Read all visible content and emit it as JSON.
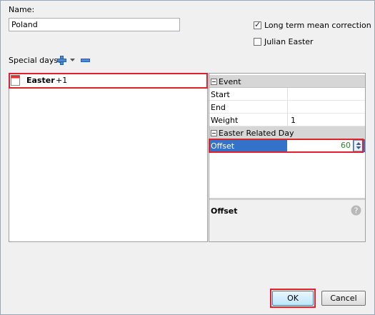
{
  "name_label": "Name:",
  "name_value": "Poland",
  "checkboxes": {
    "long_term": {
      "label": "Long term mean correction",
      "checked": true
    },
    "julian": {
      "label": "Julian Easter",
      "checked": false
    }
  },
  "special_days": {
    "label": "Special days:"
  },
  "list": {
    "items": [
      {
        "name": "Easter",
        "suffix": "+1"
      }
    ]
  },
  "properties": {
    "event_category": "Event",
    "start_label": "Start",
    "start_value": "",
    "end_label": "End",
    "end_value": "",
    "weight_label": "Weight",
    "weight_value": "1",
    "easter_category": "Easter Related Day",
    "offset_label": "Offset",
    "offset_value": "60"
  },
  "description": {
    "title": "Offset"
  },
  "buttons": {
    "ok": "OK",
    "cancel": "Cancel"
  },
  "colors": {
    "accent_red": "#e0202a",
    "selection_blue": "#3273c9"
  }
}
